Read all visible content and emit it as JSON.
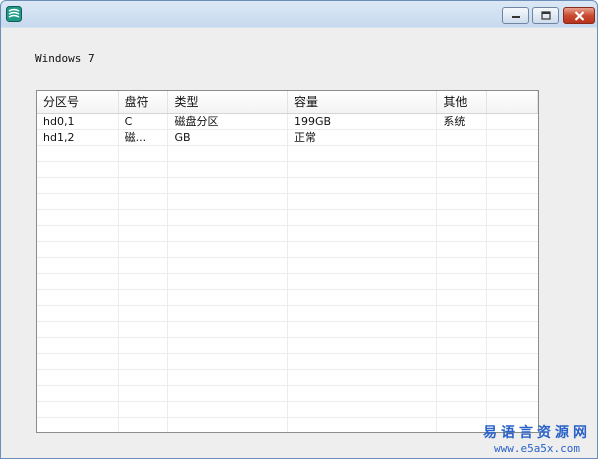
{
  "window": {
    "title": ""
  },
  "content": {
    "os_label": "Windows 7"
  },
  "listview": {
    "columns": [
      "分区号",
      "盘符",
      "类型",
      "容量",
      "其他",
      ""
    ],
    "rows": [
      [
        "hd0,1",
        "C",
        "磁盘分区",
        "199GB",
        "系统",
        ""
      ],
      [
        "hd1,2",
        "磁...",
        "GB",
        "正常",
        "",
        ""
      ]
    ]
  },
  "watermark": {
    "cn": "易语言资源网",
    "en": "www.e5a5x.com"
  },
  "colors": {
    "titlebar": "#c7d9ee",
    "close_button": "#c94a31",
    "watermark": "#2a62c9"
  },
  "icons": {
    "app": "app-icon",
    "minimize": "minimize-icon",
    "maximize": "maximize-icon",
    "close": "close-icon"
  }
}
